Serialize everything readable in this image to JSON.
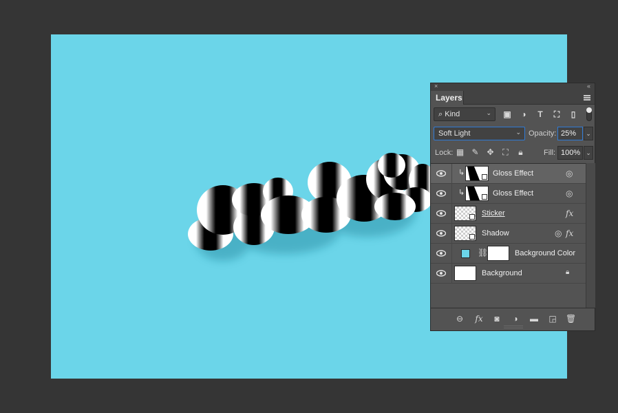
{
  "panel": {
    "title": "Layers",
    "close_glyph": "×",
    "collapse_glyph": "«"
  },
  "filter": {
    "kind_label": "Kind",
    "icons": [
      "image-filter-icon",
      "adjustment-filter-icon",
      "type-filter-icon",
      "shape-filter-icon",
      "smart-object-filter-icon"
    ]
  },
  "blend": {
    "mode": "Soft Light",
    "opacity_label": "Opacity:",
    "opacity_value": "25%"
  },
  "lock": {
    "label": "Lock:",
    "fill_label": "Fill:",
    "fill_value": "100%"
  },
  "layers": [
    {
      "name": "Gloss Effect",
      "selected": true
    },
    {
      "name": "Gloss Effect",
      "selected": false
    },
    {
      "name": "Sticker",
      "selected": false
    },
    {
      "name": "Shadow",
      "selected": false
    },
    {
      "name": "Background Color",
      "selected": false
    },
    {
      "name": "Background",
      "selected": false
    }
  ],
  "colors": {
    "canvas": "#6bd5e9",
    "panel_bg": "#535353",
    "workspace": "#353535",
    "accent": "#2f7bd6"
  },
  "bottom_icons": [
    "link-layers-icon",
    "fx-icon",
    "mask-icon",
    "adjustment-layer-icon",
    "folder-icon",
    "new-layer-icon",
    "trash-icon"
  ]
}
